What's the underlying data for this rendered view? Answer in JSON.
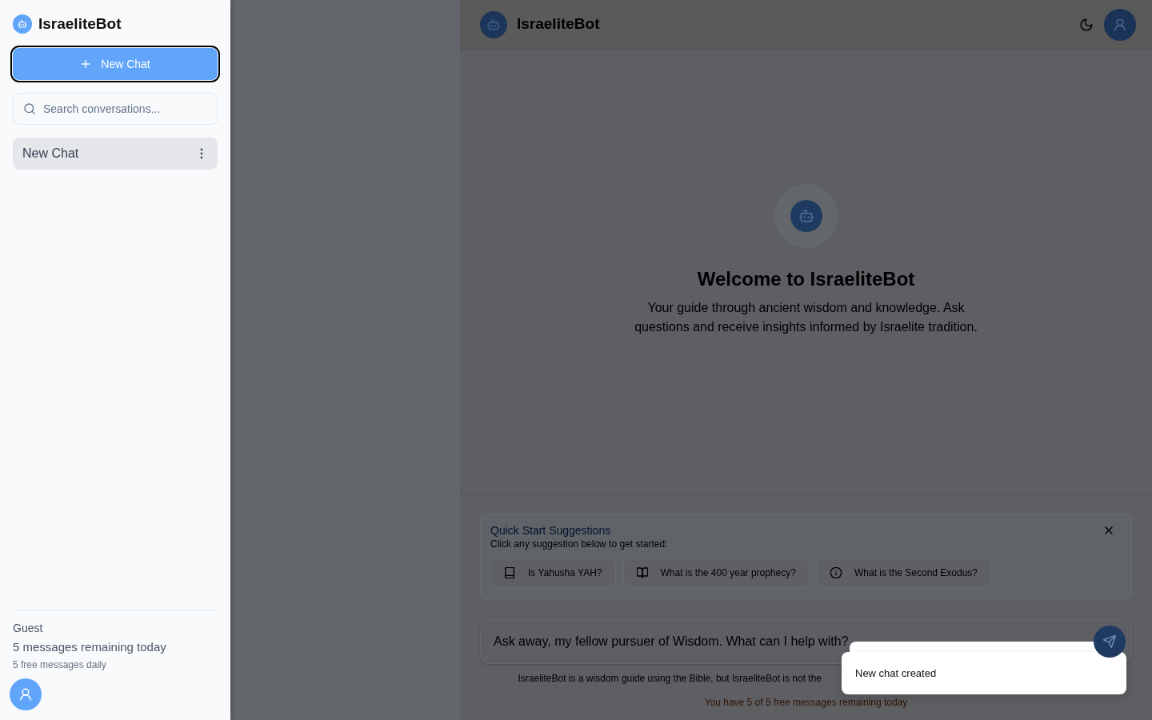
{
  "sidebar": {
    "app_name": "IsraeliteBot",
    "new_chat_button": {
      "label": "New Chat",
      "focused": true
    },
    "search": {
      "placeholder": "Search conversations..."
    },
    "conversations": [
      {
        "title": "New Chat",
        "selected": true
      }
    ],
    "user": {
      "name": "Guest",
      "remaining": "5 messages remaining today",
      "limit_note": "5 free messages daily"
    }
  },
  "header": {
    "app_name": "IsraeliteBot"
  },
  "welcome": {
    "title": "Welcome to IsraeliteBot",
    "text": "Your guide through ancient wisdom and knowledge. Ask questions and receive insights informed by Israelite tradition."
  },
  "suggestions": {
    "title": "Quick Start Suggestions",
    "subtitle": "Click any suggestion below to get started:",
    "items": [
      {
        "kind": "book",
        "label": "Is Yahusha YAH?"
      },
      {
        "kind": "open-book",
        "label": "What is the 400 year prophecy?"
      },
      {
        "kind": "info",
        "label": "What is the Second Exodus?"
      }
    ]
  },
  "composer": {
    "placeholder": "Ask away, my fellow pursuer of Wisdom. What can I help with?"
  },
  "footer": {
    "disclaimer": "IsraeliteBot is a wisdom guide using the Bible, but IsraeliteBot is not the",
    "quota": "You have 5 of 5 free messages remaining today"
  },
  "toast": {
    "message": "New chat created"
  }
}
